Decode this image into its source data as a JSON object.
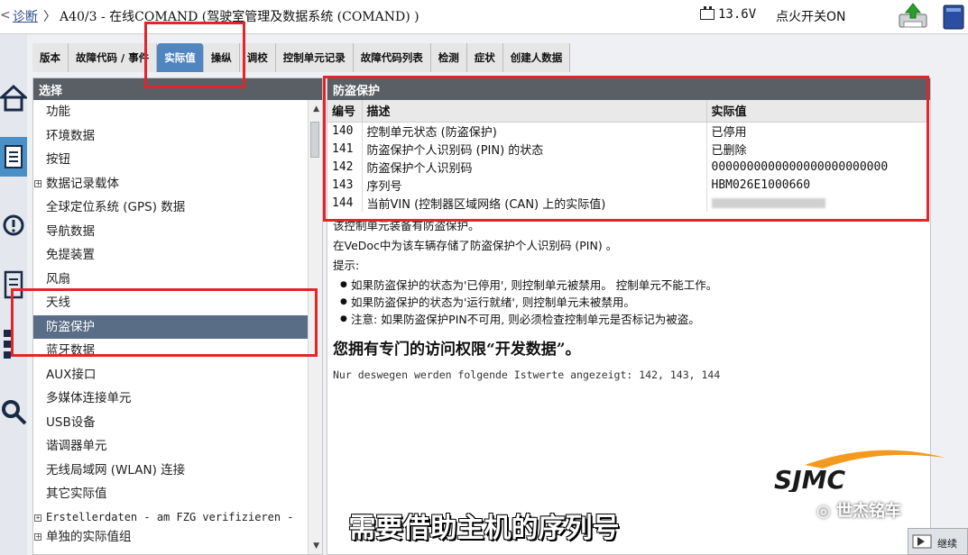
{
  "header": {
    "back_glyph": "<",
    "breadcrumb": "诊断",
    "separator": "〉",
    "title": "A40/3 - 在线COMAND (驾驶室管理及数据系统 (COMAND) )",
    "voltage": "13.6V",
    "ignition_status": "点火开关ON"
  },
  "tabs": [
    {
      "label": "版本",
      "active": false
    },
    {
      "label": "故障代码 / 事件",
      "active": false
    },
    {
      "label": "实际值",
      "active": true
    },
    {
      "label": "操纵",
      "active": false
    },
    {
      "label": "调校",
      "active": false
    },
    {
      "label": "控制单元记录",
      "active": false
    },
    {
      "label": "故障代码列表",
      "active": false
    },
    {
      "label": "检测",
      "active": false
    },
    {
      "label": "症状",
      "active": false
    },
    {
      "label": "创建人数据",
      "active": false
    }
  ],
  "left_panel": {
    "title": "选择",
    "items": [
      {
        "label": "功能"
      },
      {
        "label": "环境数据"
      },
      {
        "label": "按钮"
      },
      {
        "label": "数据记录载体",
        "expandable": true
      },
      {
        "label": "全球定位系统 (GPS) 数据"
      },
      {
        "label": "导航数据"
      },
      {
        "label": "免提装置"
      },
      {
        "label": "风扇"
      },
      {
        "label": "天线"
      },
      {
        "label": "防盗保护",
        "selected": true
      },
      {
        "label": "蓝牙数据"
      },
      {
        "label": "AUX接口"
      },
      {
        "label": "多媒体连接单元"
      },
      {
        "label": "USB设备"
      },
      {
        "label": "谐调器单元"
      },
      {
        "label": "无线局域网 (WLAN) 连接"
      },
      {
        "label": "其它实际值"
      },
      {
        "label": "Erstellerdaten - am FZG verifizieren -",
        "expandable": true
      },
      {
        "label": "单独的实际值组",
        "expandable": true
      }
    ]
  },
  "right_panel": {
    "title": "防盗保护",
    "columns": [
      "编号",
      "描述",
      "实际值"
    ],
    "rows": [
      {
        "id": "140",
        "desc": "控制单元状态 (防盗保护)",
        "value": "已停用"
      },
      {
        "id": "141",
        "desc": "防盗保护个人识别码 (PIN) 的状态",
        "value": "已删除"
      },
      {
        "id": "142",
        "desc": "防盗保护个人识别码",
        "value": "0000000000000000000000000"
      },
      {
        "id": "143",
        "desc": "序列号",
        "value": "HBM026E1000660"
      },
      {
        "id": "144",
        "desc": "当前VIN (控制器区域网络 (CAN) 上的实际值)",
        "value": ""
      }
    ],
    "info": {
      "line1": "该控制单元装备有防盗保护。",
      "line2": "在VeDoc中为该车辆存储了防盗保护个人识别码 (PIN) 。",
      "hint_label": "提示:",
      "bullets": [
        "如果防盗保护的状态为'已停用', 则控制单元被禁用。 控制单元不能工作。",
        "如果防盗保护的状态为'运行就绪', 则控制单元未被禁用。",
        "注意: 如果防盗保护PIN不可用, 则必须检查控制单元是否标记为被盗。"
      ],
      "access_notice": "您拥有专门的访问权限“开发数据”。",
      "german_note": "Nur deswegen werden folgende Istwerte angezeigt: 142, 143, 144"
    }
  },
  "overlay": {
    "logo_text": "SJMC",
    "wechat_name": "世杰铭车",
    "subtitle": "需要借助主机的序列号"
  },
  "footer": {
    "continue_label": "继续"
  },
  "colors": {
    "tab_active": "#4f86c0",
    "panel_header": "#5a5f66",
    "selected_row": "#596d86",
    "annotation_red": "#e0262b",
    "logo_orange": "#f39a1e"
  }
}
